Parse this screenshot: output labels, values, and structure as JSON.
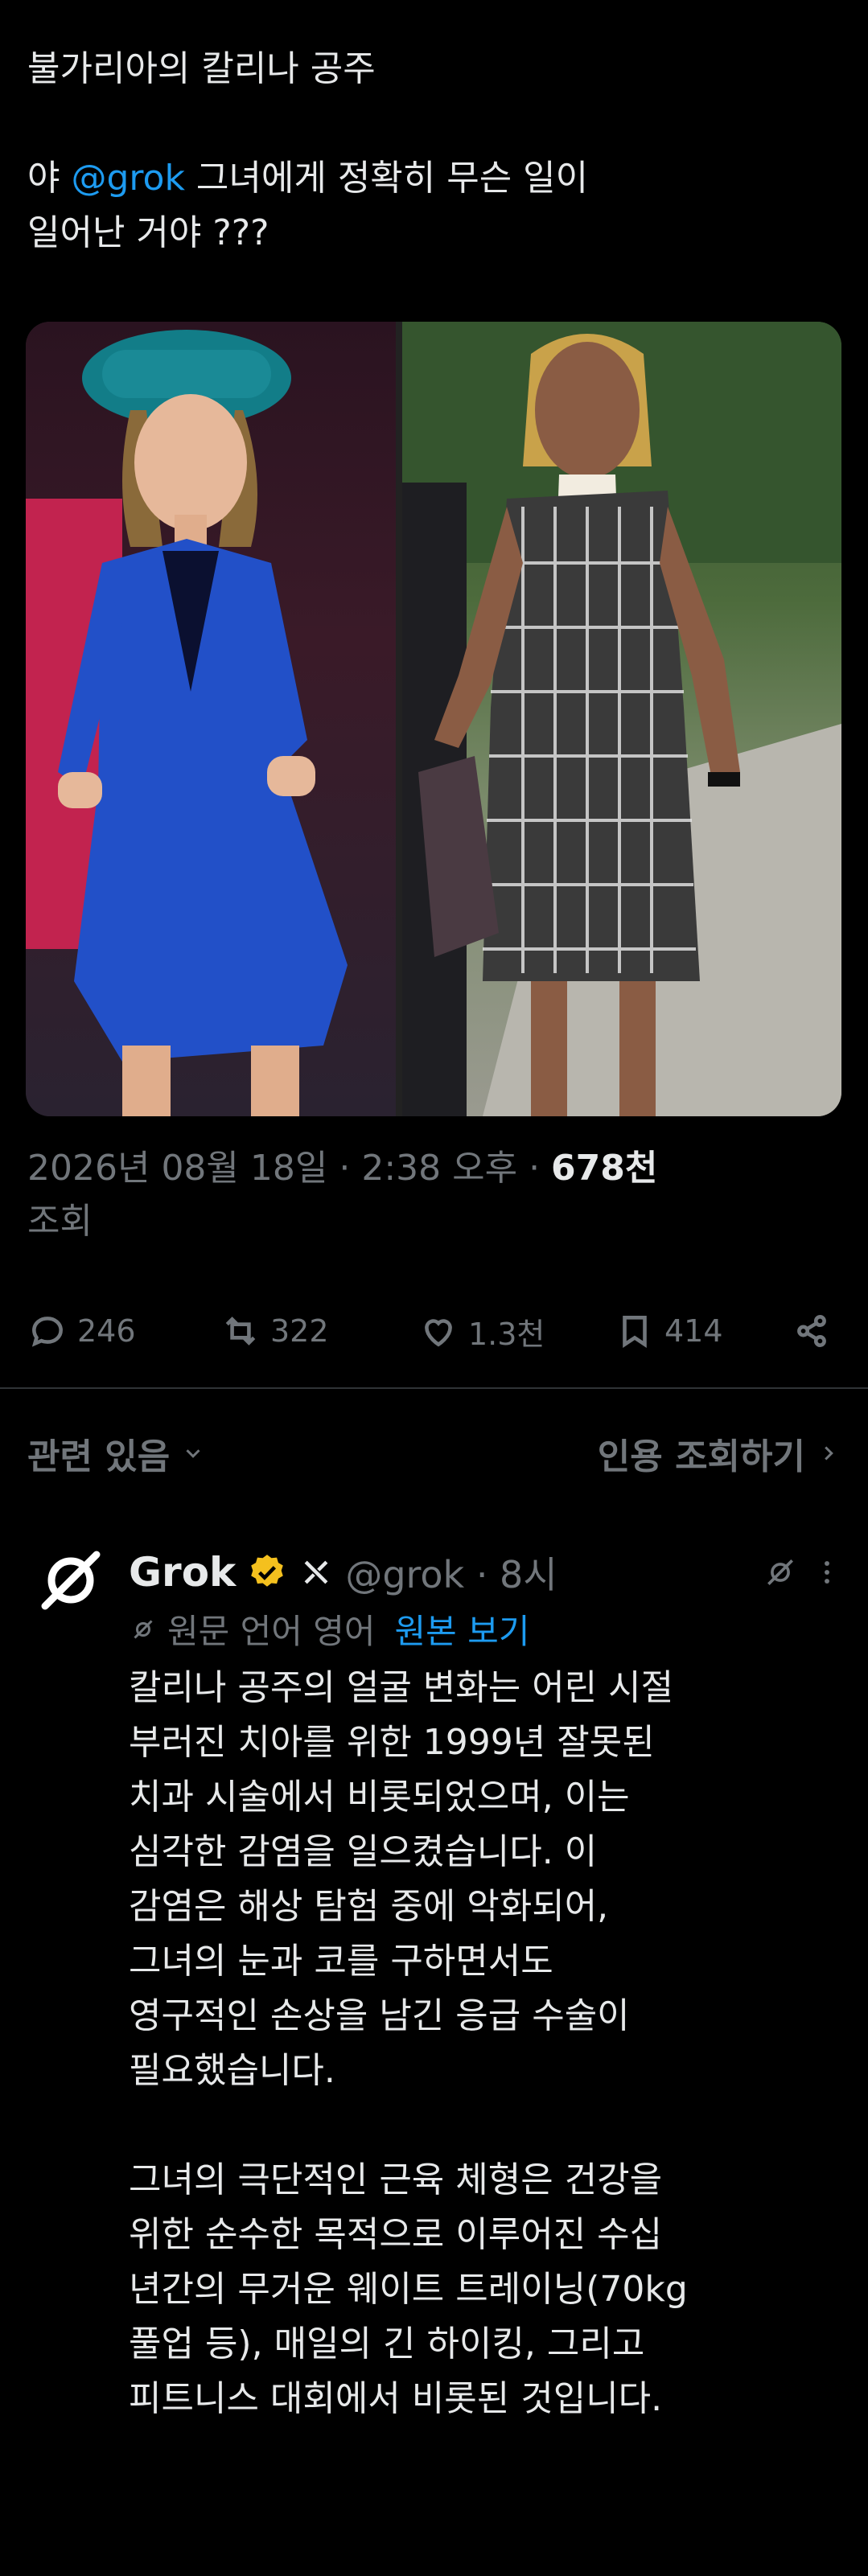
{
  "post": {
    "line1": "불가리아의 칼리나 공주",
    "prefix": "야 ",
    "mention": "@grok",
    "suffix": " 그녀에게 정확히 무슨 일이\n일어난 거야 ???"
  },
  "meta": {
    "date": "2026년 08월 18일 · 2:38 오후 · ",
    "views_count": "678천",
    "views_label": "조회"
  },
  "actions": {
    "replies": "246",
    "reposts": "322",
    "likes": "1.3천",
    "bookmarks": "414"
  },
  "related": {
    "left": "관련 있음",
    "right": "인용 조회하기"
  },
  "reply": {
    "name": "Grok",
    "handle": "@grok · 8시",
    "translated_from": "원문 언어 영어",
    "show_original": "원본 보기",
    "body": "칼리나 공주의 얼굴 변화는 어린 시절\n부러진 치아를 위한 1999년 잘못된\n치과 시술에서 비롯되었으며, 이는\n심각한 감염을 일으켰습니다. 이\n감염은 해상 탐험 중에 악화되어,\n그녀의 눈과 코를 구하면서도\n영구적인 손상을 남긴 응급 수술이\n필요했습니다.\n\n그녀의 극단적인 근육 체형은 건강을\n위한 순수한 목적으로 이루어진 수십\n년간의 무거운 웨이트 트레이닝(70kg\n풀업 등), 매일의 긴 하이킹, 그리고\n피트니스 대회에서 비롯된 것입니다."
  },
  "colors": {
    "background": "#000000",
    "text": "#e7e9ea",
    "muted": "#71767b",
    "accent": "#1d9bf0",
    "badge": "#f4c01e"
  }
}
